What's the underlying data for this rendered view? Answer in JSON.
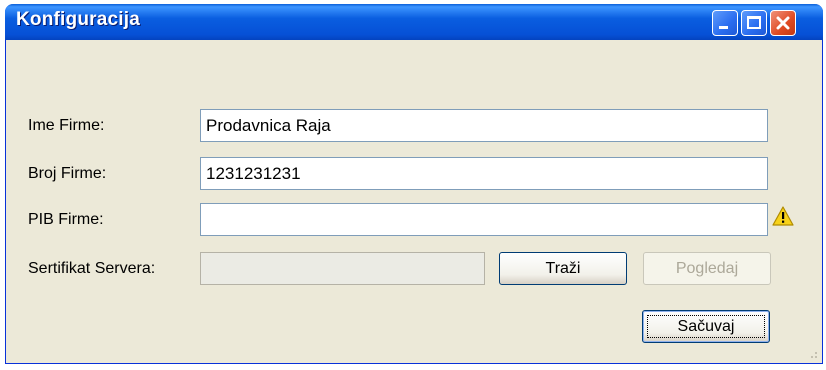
{
  "window": {
    "title": "Konfiguracija"
  },
  "form": {
    "company_name": {
      "label": "Ime Firme:",
      "value": "Prodavnica Raja"
    },
    "company_number": {
      "label": "Broj Firme:",
      "value": "1231231231"
    },
    "pib": {
      "label": "PIB Firme:",
      "value": ""
    },
    "certificate": {
      "label": "Sertifikat Servera:",
      "value": ""
    }
  },
  "buttons": {
    "browse": "Traži",
    "view": "Pogledaj",
    "save": "Sačuvaj"
  },
  "icons": {
    "warning": "warning-icon",
    "minimize": "minimize-icon",
    "maximize": "maximize-icon",
    "close": "close-icon"
  }
}
